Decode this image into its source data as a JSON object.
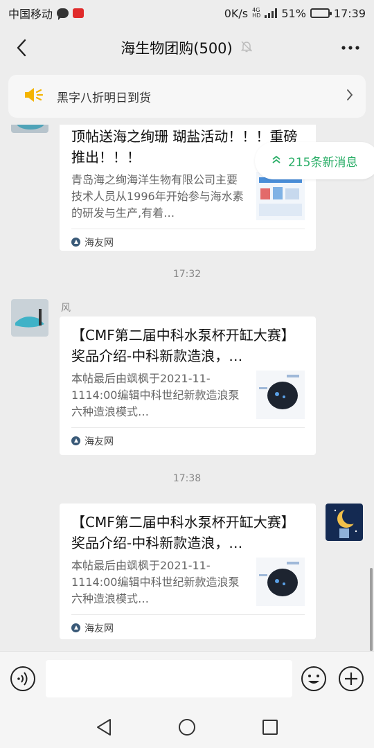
{
  "status_bar": {
    "carrier": "中国移动",
    "speed": "0K/s",
    "net_type_top": "4G",
    "net_type_bottom": "HD",
    "battery": "51%",
    "battery_level": 0.51,
    "time": "17:39"
  },
  "header": {
    "title": "海生物团购(500)",
    "back_icon": "back-chevron-icon",
    "mute_icon": "bell-muted-icon",
    "more_icon": "more-dots-icon"
  },
  "notice": {
    "icon": "speaker-icon",
    "text": "黑字八折明日到货",
    "arrow_icon": "chevron-right-icon"
  },
  "new_messages": {
    "label": "215条新消息",
    "icon": "double-chevron-up-icon",
    "color": "#2aae67"
  },
  "messages": [
    {
      "type": "card",
      "side": "left",
      "title": "顶帖送海之绚珊 瑚盐活动！！！重磅推出！！！",
      "desc": "青岛海之绚海洋生物有限公司主要技术人员从1996年开始参与海水素的研发与生产,有着…",
      "source": "海友网"
    },
    {
      "type": "time",
      "label": "17:32"
    },
    {
      "type": "card",
      "side": "left",
      "sender": "风",
      "title": "【CMF第二届中科水泵杯开缸大赛】奖品介绍-中科新款造浪，…",
      "desc": "本帖最后由飒枫于2021-11-1114:00编辑中科世纪新款造浪泵六种造浪模式…",
      "source": "海友网"
    },
    {
      "type": "time",
      "label": "17:38"
    },
    {
      "type": "card",
      "side": "right",
      "title": "【CMF第二届中科水泵杯开缸大赛】奖品介绍-中科新款造浪，…",
      "desc": "本帖最后由飒枫于2021-11-1114:00编辑中科世纪新款造浪泵六种造浪模式…",
      "source": "海友网"
    }
  ],
  "input_bar": {
    "value": "",
    "voice_icon": "voice-icon",
    "emoji_icon": "emoji-icon",
    "plus_icon": "plus-circle-icon"
  },
  "system_nav": {
    "back_icon": "triangle-back-icon",
    "home_icon": "circle-home-icon",
    "recent_icon": "square-recent-icon"
  }
}
